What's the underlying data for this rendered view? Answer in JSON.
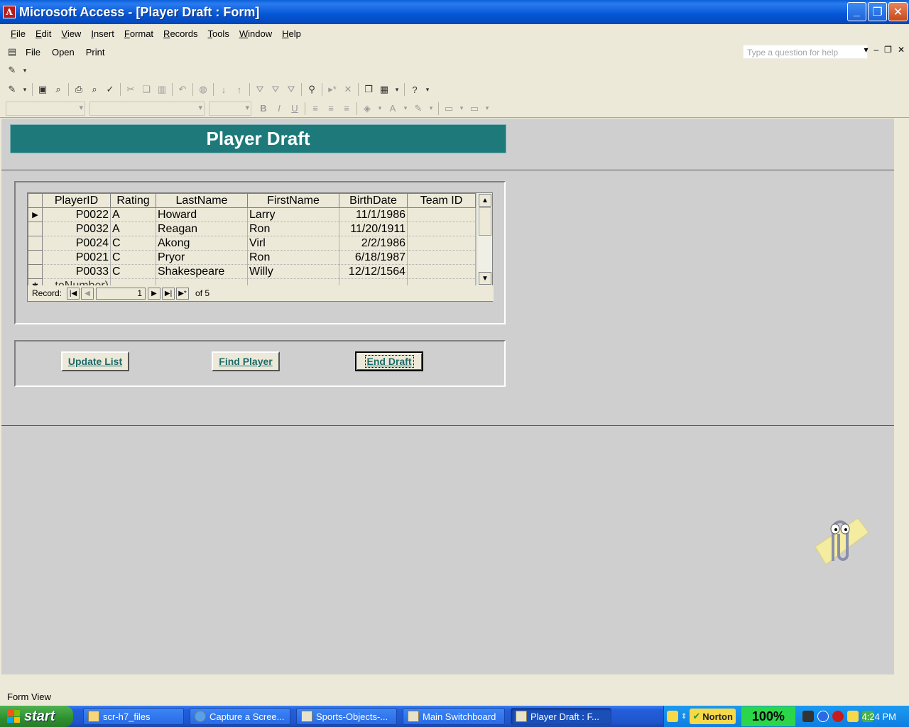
{
  "window": {
    "title": "Microsoft Access - [Player Draft : Form]"
  },
  "menu": [
    "File",
    "Edit",
    "View",
    "Insert",
    "Format",
    "Records",
    "Tools",
    "Window",
    "Help"
  ],
  "toolbar1": {
    "file": "File",
    "open": "Open",
    "print": "Print"
  },
  "help_box": {
    "placeholder": "Type a question for help"
  },
  "form": {
    "title": "Player Draft",
    "columns": [
      "PlayerID",
      "Rating",
      "LastName",
      "FirstName",
      "BirthDate",
      "Team ID"
    ],
    "rows": [
      [
        "P0022",
        "A",
        "Howard",
        "Larry",
        "11/1/1986",
        ""
      ],
      [
        "P0032",
        "A",
        "Reagan",
        "Ron",
        "11/20/1911",
        ""
      ],
      [
        "P0024",
        "C",
        "Akong",
        "Virl",
        "2/2/1986",
        ""
      ],
      [
        "P0021",
        "C",
        "Pryor",
        "Ron",
        "6/18/1987",
        ""
      ],
      [
        "P0033",
        "C",
        "Shakespeare",
        "Willy",
        "12/12/1564",
        ""
      ]
    ],
    "new_row_text": "toNumber)",
    "nav": {
      "label": "Record:",
      "current": "1",
      "of": "of 5"
    },
    "buttons": {
      "update": "Update List",
      "find": "Find Player",
      "end": "End Draft"
    }
  },
  "status": {
    "text": "Form View"
  },
  "taskbar": {
    "start": "start",
    "items": [
      "scr-h7_files",
      "Capture a Scree...",
      "Sports-Objects-...",
      "Main Switchboard",
      "Player Draft : F..."
    ],
    "norton": "Norton",
    "zoom": "100%",
    "clock": "4:24 PM"
  }
}
